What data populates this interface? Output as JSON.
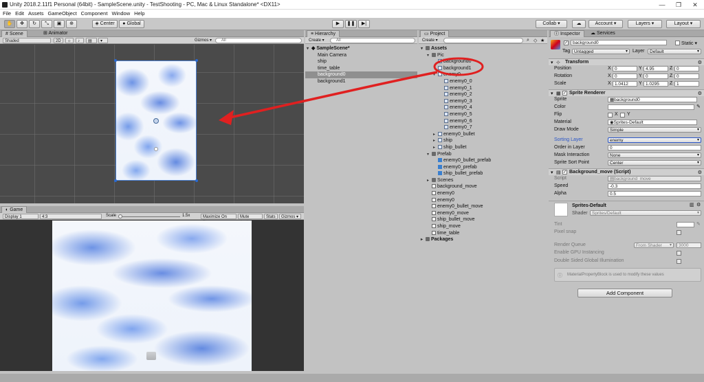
{
  "window": {
    "title": "Unity 2018.2.11f1 Personal (64bit) - SampleScene.unity - TestShooting - PC, Mac & Linux Standalone* <DX11>",
    "minimize": "—",
    "maximize": "❐",
    "close": "✕"
  },
  "menu": [
    "File",
    "Edit",
    "Assets",
    "GameObject",
    "Component",
    "Window",
    "Help"
  ],
  "toolbar": {
    "pivot": "Center",
    "space": "Global",
    "collab": "Collab ▾",
    "account": "Account ▾",
    "layers": "Layers ▾",
    "layout": "Layout ▾"
  },
  "scene_panel": {
    "tab_scene": "Scene",
    "tab_animator": "Animator",
    "shading": "Shaded",
    "mode_2d": "2D",
    "gizmos": "Gizmos ▾",
    "search_placeholder": "All"
  },
  "game_panel": {
    "tab": "Game",
    "display": "Display 1",
    "aspect": "4:3",
    "scale_label": "Scale",
    "scale_value": "1.5x",
    "maximize": "Maximize On Play",
    "mute": "Mute Audio",
    "stats": "Stats",
    "gizmos": "Gizmos ▾"
  },
  "hierarchy": {
    "tab": "Hierarchy",
    "create": "Create ▾",
    "search_placeholder": "All",
    "scene": "SampleScene*",
    "items": [
      {
        "label": "Main Camera",
        "selected": false
      },
      {
        "label": "ship",
        "selected": false
      },
      {
        "label": "time_table",
        "selected": false
      },
      {
        "label": "background0",
        "selected": true
      },
      {
        "label": "background1",
        "selected": false
      }
    ]
  },
  "project": {
    "tab": "Project",
    "create": "Create ▾",
    "items": [
      {
        "label": "Assets",
        "indent": 0,
        "icon": "folder",
        "arrow": "▾",
        "bold": true
      },
      {
        "label": "Pic",
        "indent": 1,
        "icon": "folder",
        "arrow": "▾"
      },
      {
        "label": "background0",
        "indent": 2,
        "icon": "sprite",
        "arrow": ""
      },
      {
        "label": "background1",
        "indent": 2,
        "icon": "sprite",
        "arrow": ""
      },
      {
        "label": "enemy0",
        "indent": 2,
        "icon": "sprite",
        "arrow": "▾"
      },
      {
        "label": "enemy0_0",
        "indent": 3,
        "icon": "sprite",
        "arrow": ""
      },
      {
        "label": "enemy0_1",
        "indent": 3,
        "icon": "sprite",
        "arrow": ""
      },
      {
        "label": "enemy0_2",
        "indent": 3,
        "icon": "sprite",
        "arrow": ""
      },
      {
        "label": "enemy0_3",
        "indent": 3,
        "icon": "sprite",
        "arrow": ""
      },
      {
        "label": "enemy0_4",
        "indent": 3,
        "icon": "sprite",
        "arrow": ""
      },
      {
        "label": "enemy0_5",
        "indent": 3,
        "icon": "sprite",
        "arrow": ""
      },
      {
        "label": "enemy0_6",
        "indent": 3,
        "icon": "sprite",
        "arrow": ""
      },
      {
        "label": "enemy0_7",
        "indent": 3,
        "icon": "sprite",
        "arrow": ""
      },
      {
        "label": "enemy0_bullet",
        "indent": 2,
        "icon": "sprite",
        "arrow": "▸"
      },
      {
        "label": "ship",
        "indent": 2,
        "icon": "sprite",
        "arrow": "▸"
      },
      {
        "label": "ship_bullet",
        "indent": 2,
        "icon": "sprite",
        "arrow": "▸"
      },
      {
        "label": "Prefab",
        "indent": 1,
        "icon": "folder",
        "arrow": "▾"
      },
      {
        "label": "enemy0_bullet_prefab",
        "indent": 2,
        "icon": "prefab",
        "arrow": ""
      },
      {
        "label": "enemy0_prefab",
        "indent": 2,
        "icon": "prefab",
        "arrow": ""
      },
      {
        "label": "ship_bullet_prefab",
        "indent": 2,
        "icon": "prefab",
        "arrow": ""
      },
      {
        "label": "Scenes",
        "indent": 1,
        "icon": "folder",
        "arrow": "▸"
      },
      {
        "label": "background_move",
        "indent": 1,
        "icon": "script",
        "arrow": ""
      },
      {
        "label": "enemy0",
        "indent": 1,
        "icon": "script",
        "arrow": ""
      },
      {
        "label": "enemy0",
        "indent": 1,
        "icon": "script",
        "arrow": ""
      },
      {
        "label": "enemy0_bullet_move",
        "indent": 1,
        "icon": "script",
        "arrow": ""
      },
      {
        "label": "enemy0_move",
        "indent": 1,
        "icon": "script",
        "arrow": ""
      },
      {
        "label": "ship_bullet_move",
        "indent": 1,
        "icon": "script",
        "arrow": ""
      },
      {
        "label": "ship_move",
        "indent": 1,
        "icon": "script",
        "arrow": ""
      },
      {
        "label": "time_table",
        "indent": 1,
        "icon": "script",
        "arrow": ""
      },
      {
        "label": "Packages",
        "indent": 0,
        "icon": "folder",
        "arrow": "▸",
        "bold": true
      }
    ]
  },
  "inspector": {
    "tab_inspector": "Inspector",
    "tab_services": "Services",
    "object_name": "background0",
    "static": "Static ▾",
    "tag_label": "Tag",
    "tag_value": "Untagged",
    "layer_label": "Layer",
    "layer_value": "Default",
    "transform": {
      "title": "Transform",
      "position_label": "Position",
      "rotation_label": "Rotation",
      "scale_label": "Scale",
      "position": [
        "0",
        "4.95",
        "0"
      ],
      "rotation": [
        "0",
        "0",
        "0"
      ],
      "scale": [
        "1.0412",
        "1.0295",
        "1"
      ],
      "x": "X",
      "y": "Y",
      "z": "Z"
    },
    "sprite_renderer": {
      "title": "Sprite Renderer",
      "sprite_label": "Sprite",
      "sprite_value": "background0",
      "color_label": "Color",
      "flip_label": "Flip",
      "flip_x": "X",
      "flip_y": "Y",
      "material_label": "Material",
      "material_value": "Sprites-Default",
      "draw_mode_label": "Draw Mode",
      "draw_mode_value": "Simple",
      "sorting_layer_label": "Sorting Layer",
      "sorting_layer_value": "enemy",
      "order_label": "Order in Layer",
      "order_value": "0",
      "mask_label": "Mask Interaction",
      "mask_value": "None",
      "sort_point_label": "Sprite Sort Point",
      "sort_point_value": "Center"
    },
    "bg_move": {
      "title": "Background_move (Script)",
      "script_label": "Script",
      "script_value": "background_move",
      "speed_label": "Speed",
      "speed_value": "-0.3",
      "alpha_label": "Alpha",
      "alpha_value": "0.5"
    },
    "material": {
      "name": "Sprites-Default",
      "shader_label": "Shader",
      "shader_value": "Sprites/Default",
      "tint_label": "Tint",
      "pixel_snap_label": "Pixel snap",
      "render_queue_label": "Render Queue",
      "render_queue_mode": "From Shader",
      "render_queue_value": "3000",
      "gpu_label": "Enable GPU Instancing",
      "dsgi_label": "Double Sided Global Illumination",
      "info": "MaterialPropertyBlock is used to modify these values"
    },
    "add_component": "Add Component"
  },
  "colors": {
    "annotation_red": "#e02020",
    "selection": "#8f8f8f",
    "sorting_layer_blue": "#2a55c8",
    "prefab_blue": "#3a7fcf"
  }
}
